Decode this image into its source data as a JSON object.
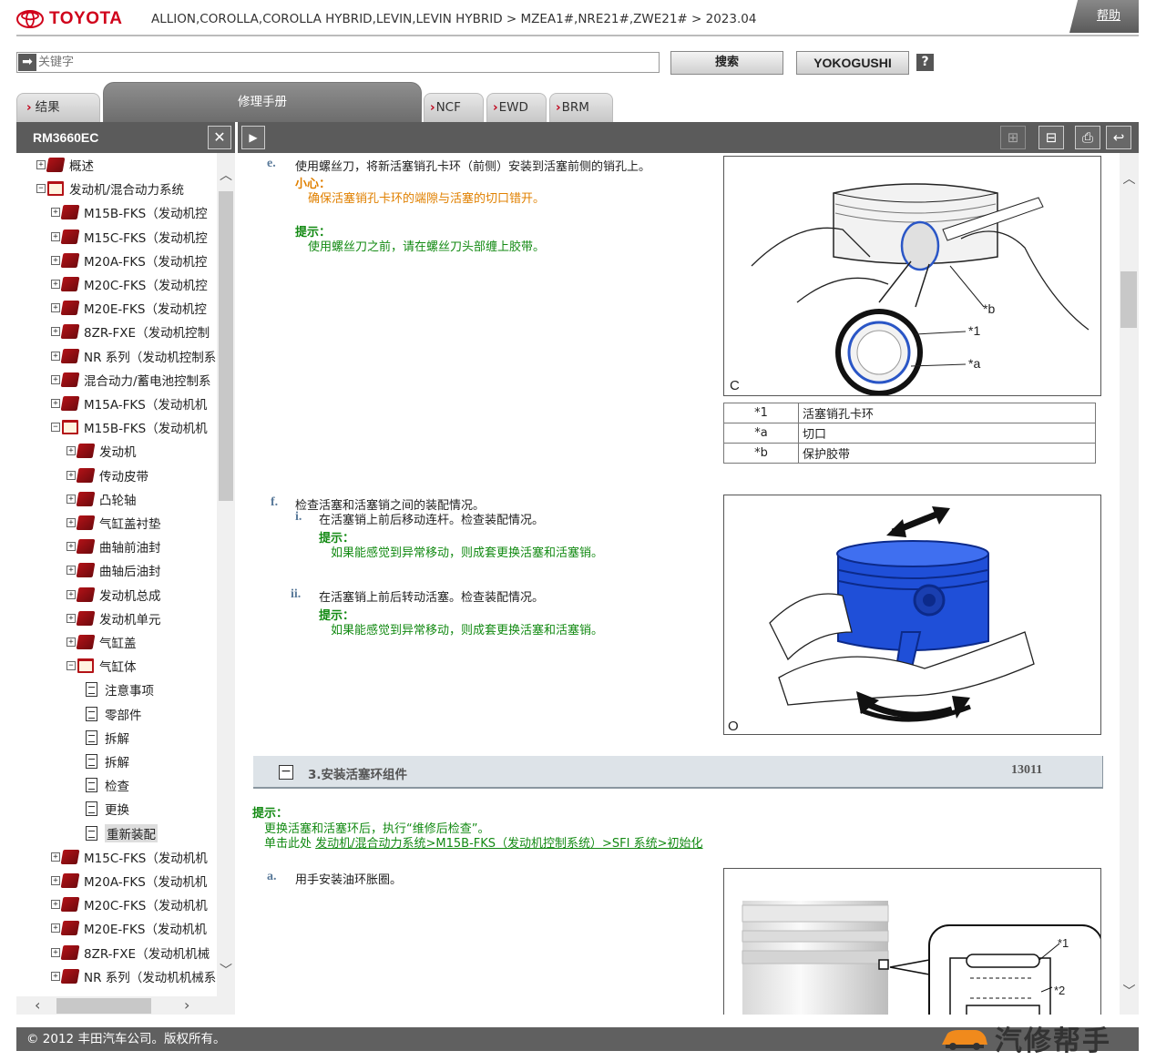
{
  "header": {
    "brand": "TOYOTA",
    "breadcrumb": "ALLION,COROLLA,COROLLA HYBRID,LEVIN,LEVIN HYBRID > MZEA1#,NRE21#,ZWE21# > 2023.04",
    "help_label": "帮助"
  },
  "search": {
    "placeholder": "关键字",
    "search_label": "搜索",
    "yokogushi_label": "YOKOGUSHI",
    "help_icon": "?"
  },
  "tabs": [
    {
      "label": "结果"
    },
    {
      "label": "修理手册"
    },
    {
      "label": "NCF"
    },
    {
      "label": "EWD"
    },
    {
      "label": "BRM"
    }
  ],
  "toolbar": {
    "manual_code": "RM3660EC",
    "close_icon": "close-icon",
    "expand_icon": "play-icon"
  },
  "tree": [
    {
      "label": "概述",
      "level": 0,
      "toggle": "+",
      "icon": "book-closed"
    },
    {
      "label": "发动机/混合动力系统",
      "level": 0,
      "toggle": "-",
      "icon": "book-open"
    },
    {
      "label": "M15B-FKS（发动机控",
      "level": 1,
      "toggle": "+",
      "icon": "book-closed"
    },
    {
      "label": "M15C-FKS（发动机控",
      "level": 1,
      "toggle": "+",
      "icon": "book-closed"
    },
    {
      "label": "M20A-FKS（发动机控",
      "level": 1,
      "toggle": "+",
      "icon": "book-closed"
    },
    {
      "label": "M20C-FKS（发动机控",
      "level": 1,
      "toggle": "+",
      "icon": "book-closed"
    },
    {
      "label": "M20E-FKS（发动机控",
      "level": 1,
      "toggle": "+",
      "icon": "book-closed"
    },
    {
      "label": "8ZR-FXE（发动机控制",
      "level": 1,
      "toggle": "+",
      "icon": "book-closed"
    },
    {
      "label": "NR 系列（发动机控制系",
      "level": 1,
      "toggle": "+",
      "icon": "book-closed"
    },
    {
      "label": "混合动力/蓄电池控制系",
      "level": 1,
      "toggle": "+",
      "icon": "book-closed"
    },
    {
      "label": "M15A-FKS（发动机机",
      "level": 1,
      "toggle": "+",
      "icon": "book-closed"
    },
    {
      "label": "M15B-FKS（发动机机",
      "level": 1,
      "toggle": "-",
      "icon": "book-open"
    },
    {
      "label": "发动机",
      "level": 2,
      "toggle": "+",
      "icon": "book-closed"
    },
    {
      "label": "传动皮带",
      "level": 2,
      "toggle": "+",
      "icon": "book-closed"
    },
    {
      "label": "凸轮轴",
      "level": 2,
      "toggle": "+",
      "icon": "book-closed"
    },
    {
      "label": "气缸盖衬垫",
      "level": 2,
      "toggle": "+",
      "icon": "book-closed"
    },
    {
      "label": "曲轴前油封",
      "level": 2,
      "toggle": "+",
      "icon": "book-closed"
    },
    {
      "label": "曲轴后油封",
      "level": 2,
      "toggle": "+",
      "icon": "book-closed"
    },
    {
      "label": "发动机总成",
      "level": 2,
      "toggle": "+",
      "icon": "book-closed"
    },
    {
      "label": "发动机单元",
      "level": 2,
      "toggle": "+",
      "icon": "book-closed"
    },
    {
      "label": "气缸盖",
      "level": 2,
      "toggle": "+",
      "icon": "book-closed"
    },
    {
      "label": "气缸体",
      "level": 2,
      "toggle": "-",
      "icon": "book-open"
    },
    {
      "label": "注意事项",
      "level": 3,
      "toggle": "",
      "icon": "doc"
    },
    {
      "label": "零部件",
      "level": 3,
      "toggle": "",
      "icon": "doc"
    },
    {
      "label": "拆解",
      "level": 3,
      "toggle": "",
      "icon": "doc"
    },
    {
      "label": "拆解",
      "level": 3,
      "toggle": "",
      "icon": "doc"
    },
    {
      "label": "检查",
      "level": 3,
      "toggle": "",
      "icon": "doc"
    },
    {
      "label": "更换",
      "level": 3,
      "toggle": "",
      "icon": "doc"
    },
    {
      "label": "重新装配",
      "level": 3,
      "toggle": "",
      "icon": "doc",
      "selected": true
    },
    {
      "label": "M15C-FKS（发动机机",
      "level": 1,
      "toggle": "+",
      "icon": "book-closed"
    },
    {
      "label": "M20A-FKS（发动机机",
      "level": 1,
      "toggle": "+",
      "icon": "book-closed"
    },
    {
      "label": "M20C-FKS（发动机机",
      "level": 1,
      "toggle": "+",
      "icon": "book-closed"
    },
    {
      "label": "M20E-FKS（发动机机",
      "level": 1,
      "toggle": "+",
      "icon": "book-closed"
    },
    {
      "label": "8ZR-FXE（发动机机械",
      "level": 1,
      "toggle": "+",
      "icon": "book-closed"
    },
    {
      "label": "NR 系列（发动机机械系",
      "level": 1,
      "toggle": "+",
      "icon": "book-closed"
    }
  ],
  "content": {
    "step_e": {
      "marker": "e.",
      "text": "使用螺丝刀，将新活塞销孔卡环（前侧）安装到活塞前侧的销孔上。",
      "caution_head": "小心：",
      "caution_text": "确保活塞销孔卡环的端隙与活塞的切口错开。",
      "hint_head": "提示：",
      "hint_text": "使用螺丝刀之前，请在螺丝刀头部缠上胶带。",
      "figure_corner": "C",
      "callouts": [
        "*b",
        "*1",
        "*a"
      ],
      "legend": [
        {
          "key": "*1",
          "value": "活塞销孔卡环"
        },
        {
          "key": "*a",
          "value": "切口"
        },
        {
          "key": "*b",
          "value": "保护胶带"
        }
      ]
    },
    "step_f": {
      "marker": "f.",
      "text": "检查活塞和活塞销之间的装配情况。",
      "sub_i_marker": "i.",
      "sub_i_text": "在活塞销上前后移动连杆。检查装配情况。",
      "sub_i_hint_head": "提示：",
      "sub_i_hint_text": "如果能感觉到异常移动，则成套更换活塞和活塞销。",
      "sub_ii_marker": "ii.",
      "sub_ii_text": "在活塞销上前后转动活塞。检查装配情况。",
      "sub_ii_hint_head": "提示：",
      "sub_ii_hint_text": "如果能感觉到异常移动，则成套更换活塞和活塞销。",
      "figure_corner": "O"
    },
    "section3": {
      "title": "3.安装活塞环组件",
      "code": "13011",
      "hint_head": "提示：",
      "hint_line1": "更换活塞和活塞环后，执行“维修后检查”。",
      "hint_line2_prefix": "单击此处 ",
      "hint_link": "发动机/混合动力系统>M15B-FKS（发动机控制系统）>SFI 系统>初始化"
    },
    "step_a": {
      "marker": "a.",
      "text": "用手安装油环胀圈。",
      "callouts": [
        "*1",
        "*2"
      ]
    }
  },
  "footer": {
    "copyright": "© 2012 丰田汽车公司。版权所有。",
    "watermark": "汽修帮手"
  },
  "colors": {
    "brand_red": "#d0021b",
    "hint_green": "#138a13",
    "caution_orange": "#e08000",
    "piston_blue": "#1f4fd8"
  }
}
